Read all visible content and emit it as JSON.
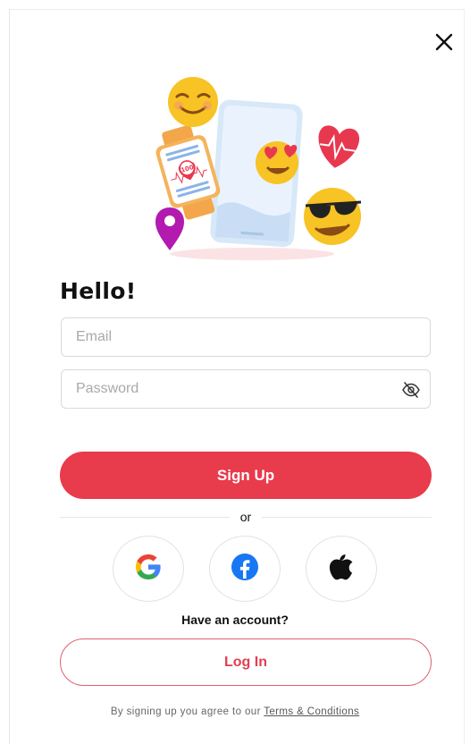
{
  "header": {
    "close_icon": "close-icon"
  },
  "hero": {
    "illustration": "phone-emoji-smartwatch-illustration"
  },
  "form": {
    "title": "Hello!",
    "email": {
      "value": "",
      "placeholder": "Email"
    },
    "password": {
      "value": "",
      "placeholder": "Password",
      "toggle_icon": "eye-slash-icon"
    },
    "signup_label": "Sign Up",
    "divider_label": "or"
  },
  "social": {
    "buttons": [
      {
        "icon": "google-icon"
      },
      {
        "icon": "facebook-icon"
      },
      {
        "icon": "apple-icon"
      }
    ]
  },
  "login": {
    "prompt": "Have an account?",
    "button_label": "Log In"
  },
  "footer": {
    "terms_prefix": "By signing up you agree to our",
    "terms_link": "Terms & Conditions"
  },
  "colors": {
    "accent": "#e83b4c",
    "heart": "#e8384f",
    "emoji_yellow": "#f7c325",
    "pin": "#b21ab0"
  }
}
